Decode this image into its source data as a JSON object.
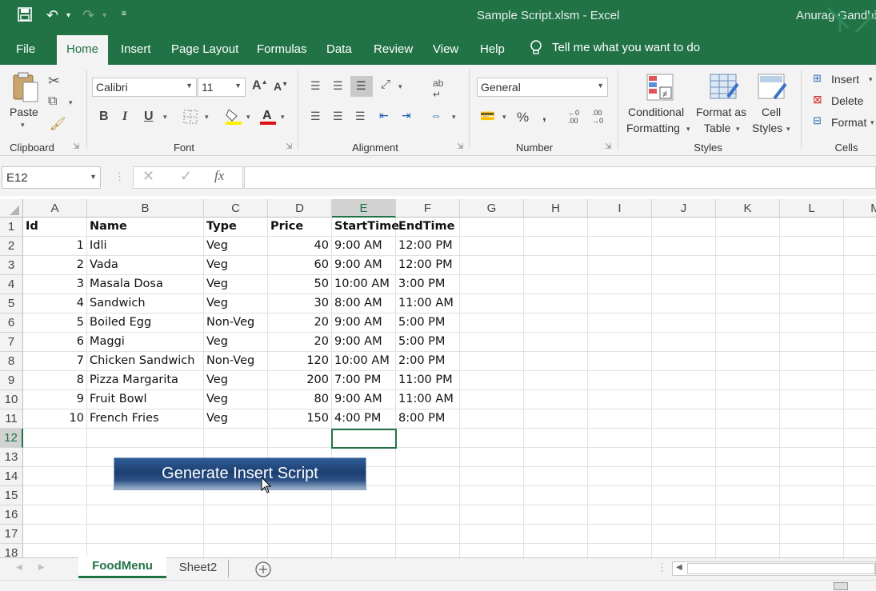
{
  "window": {
    "title": "Sample Script.xlsm  -  Excel",
    "user": "Anurag Gandhi"
  },
  "quick_access": {
    "save_icon": "save-icon",
    "undo_icon": "undo-icon",
    "redo_icon": "redo-icon",
    "customize_icon": "customize-icon"
  },
  "tabs": [
    {
      "label": "File"
    },
    {
      "label": "Home"
    },
    {
      "label": "Insert"
    },
    {
      "label": "Page Layout"
    },
    {
      "label": "Formulas"
    },
    {
      "label": "Data"
    },
    {
      "label": "Review"
    },
    {
      "label": "View"
    },
    {
      "label": "Help"
    }
  ],
  "tell_me": "Tell me what you want to do",
  "ribbon": {
    "clipboard": {
      "label": "Clipboard",
      "paste": "Paste"
    },
    "font": {
      "label": "Font",
      "name": "Calibri",
      "size": "11"
    },
    "alignment": {
      "label": "Alignment"
    },
    "number": {
      "label": "Number",
      "format": "General"
    },
    "styles": {
      "label": "Styles",
      "conditional_1": "Conditional",
      "conditional_2": "Formatting",
      "table_1": "Format as",
      "table_2": "Table",
      "cell_1": "Cell",
      "cell_2": "Styles"
    },
    "cells": {
      "label": "Cells",
      "insert": "Insert",
      "delete": "Delete",
      "format": "Format"
    }
  },
  "formula_bar": {
    "name_box": "E12",
    "fx": "fx",
    "value": ""
  },
  "columns": [
    "A",
    "B",
    "C",
    "D",
    "E",
    "F",
    "G",
    "H",
    "I",
    "J",
    "K",
    "L",
    "M"
  ],
  "rows": [
    "1",
    "2",
    "3",
    "4",
    "5",
    "6",
    "7",
    "8",
    "9",
    "10",
    "11",
    "12",
    "13",
    "14",
    "15",
    "16",
    "17",
    "18"
  ],
  "table": {
    "headers": [
      "Id",
      "Name",
      "Type",
      "Price",
      "StartTime",
      "EndTime"
    ],
    "rows": [
      [
        "1",
        "Idli",
        "Veg",
        "40",
        "9:00 AM",
        "12:00 PM"
      ],
      [
        "2",
        "Vada",
        "Veg",
        "60",
        "9:00 AM",
        "12:00 PM"
      ],
      [
        "3",
        "Masala Dosa",
        "Veg",
        "50",
        "10:00 AM",
        "3:00 PM"
      ],
      [
        "4",
        "Sandwich",
        "Veg",
        "30",
        "8:00 AM",
        "11:00 AM"
      ],
      [
        "5",
        "Boiled Egg",
        "Non-Veg",
        "20",
        "9:00 AM",
        "5:00 PM"
      ],
      [
        "6",
        "Maggi",
        "Veg",
        "20",
        "9:00 AM",
        "5:00 PM"
      ],
      [
        "7",
        "Chicken Sandwich",
        "Non-Veg",
        "120",
        "10:00 AM",
        "2:00 PM"
      ],
      [
        "8",
        "Pizza Margarita",
        "Veg",
        "200",
        "7:00 PM",
        "11:00 PM"
      ],
      [
        "9",
        "Fruit Bowl",
        "Veg",
        "80",
        "9:00 AM",
        "11:00 AM"
      ],
      [
        "10",
        "French Fries",
        "Veg",
        "150",
        "4:00 PM",
        "8:00 PM"
      ]
    ]
  },
  "macro_button": "Generate Insert Script",
  "sheets": [
    {
      "label": "FoodMenu",
      "active": true
    },
    {
      "label": "Sheet2",
      "active": false
    }
  ],
  "colors": {
    "brand": "#217346",
    "button": "#1d3f72"
  }
}
